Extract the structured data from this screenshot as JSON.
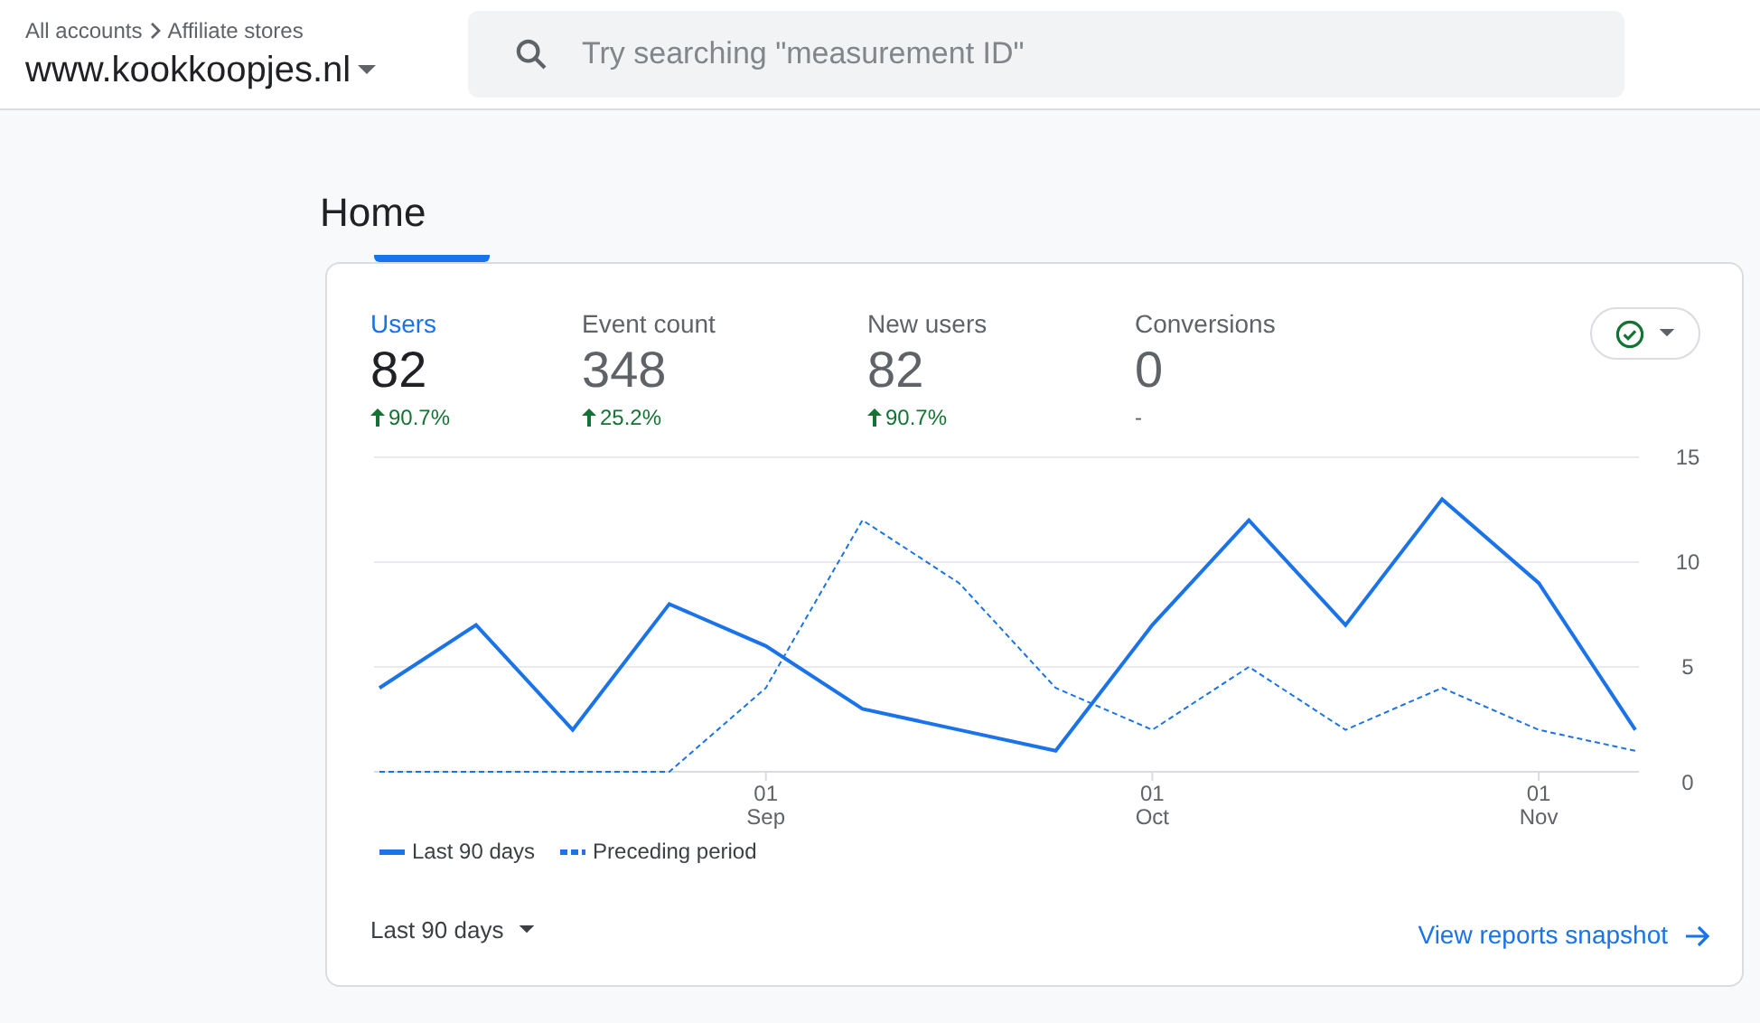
{
  "header": {
    "breadcrumb": [
      "All accounts",
      "Affiliate stores"
    ],
    "property": "www.kookkoopjes.nl",
    "search": {
      "placeholder": "Try searching \"measurement ID\""
    }
  },
  "page_title": "Home",
  "card": {
    "metrics": [
      {
        "label": "Users",
        "value": "82",
        "change": "90.7%",
        "kind": "increase",
        "selected": true
      },
      {
        "label": "Event count",
        "value": "348",
        "change": "25.2%",
        "kind": "increase",
        "selected": false
      },
      {
        "label": "New users",
        "value": "82",
        "change": "90.7%",
        "kind": "increase",
        "selected": false
      },
      {
        "label": "Conversions",
        "value": "0",
        "change": "-",
        "kind": "flat",
        "selected": false
      }
    ],
    "chart_data": {
      "type": "line",
      "categories": [
        null,
        null,
        null,
        null,
        "01 Sep",
        null,
        null,
        null,
        "01 Oct",
        null,
        null,
        null,
        "01 Nov",
        null
      ],
      "series": [
        {
          "name": "Last 90 days",
          "color": "#1a73e8",
          "line_style": "solid",
          "values": [
            4,
            7,
            2,
            8,
            6,
            3,
            2,
            1,
            7,
            12,
            7,
            13,
            9,
            2
          ]
        },
        {
          "name": "Preceding period",
          "color": "#1a73e8",
          "line_style": "dashed",
          "values": [
            0,
            0,
            0,
            0,
            4,
            12,
            9,
            4,
            2,
            5,
            2,
            4,
            2,
            1
          ]
        }
      ],
      "yticks": [
        0,
        5,
        10,
        15
      ],
      "ylim": [
        0,
        15
      ]
    },
    "date_range": "Last 90 days",
    "link": "View reports snapshot"
  }
}
